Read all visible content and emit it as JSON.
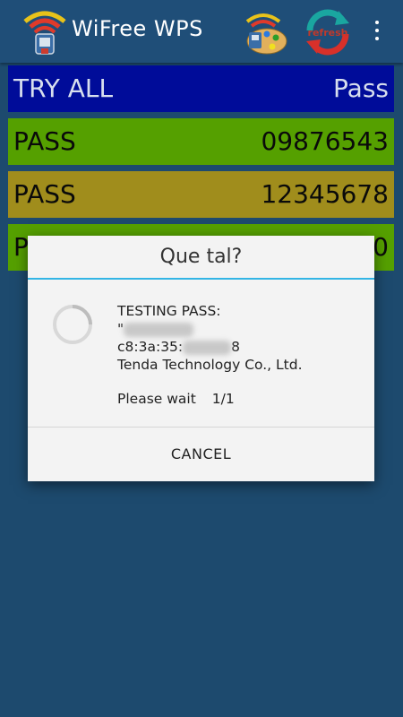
{
  "appbar": {
    "title": "WiFree WPS",
    "refresh_label": "refresh",
    "menu_icon": "overflow-menu-icon"
  },
  "rows": [
    {
      "left": "TRY ALL",
      "right": "Pass",
      "color": "#000c99"
    },
    {
      "left": "PASS",
      "right": "09876543",
      "color": "#55a000"
    },
    {
      "left": "PASS",
      "right": "12345678",
      "color": "#a08d1c"
    },
    {
      "left": "P",
      "right": "0",
      "color": "#55a000"
    }
  ],
  "dialog": {
    "title": "Que tal?",
    "line1": "TESTING PASS:",
    "line2_prefix": "\"",
    "line3_prefix": "c8:3a:35:",
    "line3_suffix": "8",
    "line4": "Tenda Technology Co., Ltd.",
    "wait_label": "Please wait",
    "wait_count": "1/1",
    "cancel_label": "CANCEL"
  },
  "colors": {
    "background": "#1d4a6e",
    "appbar": "#1f4e78",
    "accent": "#33b5e5"
  }
}
